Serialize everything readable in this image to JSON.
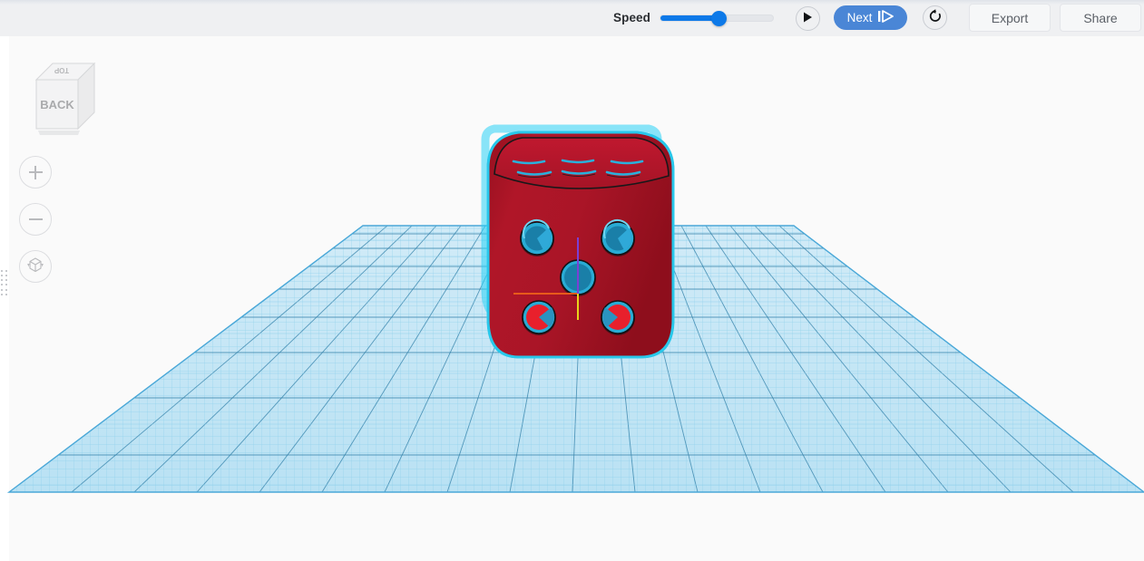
{
  "app": {
    "name": "3d-model-viewer",
    "canvas_background": "#fafafa"
  },
  "toolbar": {
    "speed_label": "Speed",
    "speed_slider": {
      "name": "speed-slider",
      "value_percent": 52,
      "min": 0,
      "max": 100,
      "fill_color": "#0d79e8",
      "track_color": "#e4e6ea"
    },
    "play_button": {
      "label": "",
      "icon": "play-icon"
    },
    "next_button": {
      "label": "Next",
      "icon": "step-forward-icon",
      "background": "#4a86d6",
      "text_color": "#ffffff"
    },
    "reset_button": {
      "label": "",
      "icon": "rotate-ccw-icon"
    },
    "export_label": "Export",
    "share_label": "Share",
    "background": "#eff0f2"
  },
  "viewport": {
    "view_cube": {
      "name": "view-cube",
      "front_face_label": "BACK",
      "top_face_label": "TOP",
      "face_color": "#f2f2f2",
      "edge_color": "#d0d0d0",
      "text_color": "#9a9a9a"
    },
    "tools": [
      {
        "name": "zoom-in-button",
        "icon": "plus-icon",
        "label": ""
      },
      {
        "name": "zoom-out-button",
        "icon": "minus-icon",
        "label": ""
      },
      {
        "name": "fit-view-button",
        "icon": "fit-to-view-cube-icon",
        "label": ""
      }
    ],
    "grip_handle": {
      "name": "panel-resize-grip",
      "label": ""
    },
    "build_plate": {
      "name": "build-plate-grid",
      "fill_color": "#bfe4f5",
      "minor_line_color": "#8fd0ec",
      "major_line_color": "#2f7fa8",
      "edge_color": "#4aa8d8"
    },
    "model": {
      "name": "dice-model",
      "shape": "rounded-cube-die",
      "body_color": "#a5152a",
      "body_highlight_color": "#c0182f",
      "outline_color": "#2ad2f5",
      "pip_rim_color": "#29abd4",
      "pip_fill_color": "#1a7fa8",
      "pip_red_fill_color": "#e8202c",
      "front_face_pip_count": 5,
      "top_face_pip_count": 6,
      "selected": true
    },
    "axis_indicator": {
      "name": "axis-indicator",
      "x_axis_color": "#e85a1a",
      "y_axis_color": "#e8d41a",
      "z_axis_color": "#7b3fd4"
    }
  }
}
